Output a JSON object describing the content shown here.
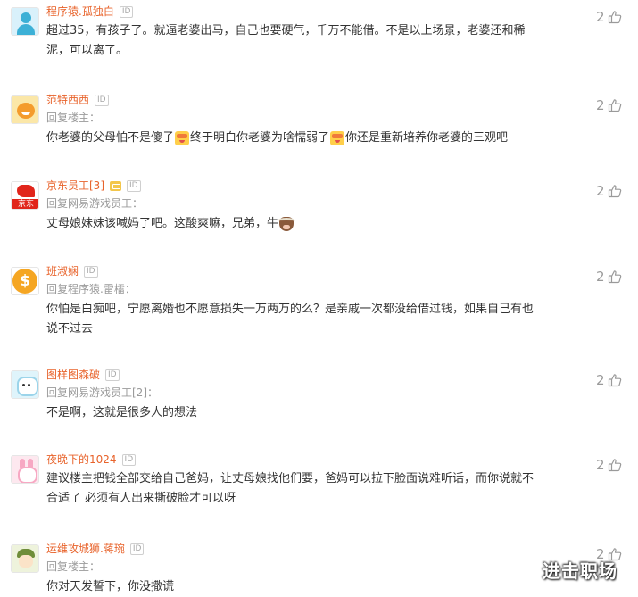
{
  "comments": [
    {
      "avatar": "person-avatar",
      "username": "程序猿.孤独白",
      "id_badge": "ID",
      "reply": "",
      "lines": [
        [
          {
            "text": "超过35，有孩子了。就逼老婆出马，自己也要硬气，千万不能借。不是以上场景，老婆还和稀"
          }
        ],
        [
          {
            "text": "泥，可以离了。"
          }
        ]
      ],
      "likes": "2"
    },
    {
      "avatar": "smile-face-avatar",
      "username": "范特西西",
      "id_badge": "ID",
      "reply": "回复楼主：",
      "lines": [
        [
          {
            "text": "你老婆的父母怕不是傻子"
          },
          {
            "emoji": "facepalm-emoji"
          },
          {
            "text": "终于明白你老婆为啥懦弱了"
          },
          {
            "emoji": "facepalm-emoji"
          },
          {
            "text": "你还是重新培养你老婆的三观吧"
          }
        ]
      ],
      "likes": "2"
    },
    {
      "avatar": "jd-logo-avatar",
      "avatar_text": "京东",
      "username": "京东员工[3]",
      "level_badge": true,
      "id_badge": "ID",
      "reply": "回复网易游戏员工：",
      "lines": [
        [
          {
            "text": "丈母娘妹妹该喊妈了吧。这酸爽嘛，兄弟，牛"
          },
          {
            "emoji": "cow-emoji"
          }
        ]
      ],
      "likes": "2"
    },
    {
      "avatar": "coin-avatar",
      "avatar_text": "$",
      "username": "班淑娴",
      "id_badge": "ID",
      "reply": "回复程序猿.雷檑：",
      "lines": [
        [
          {
            "text": "你怕是白痴吧，宁愿离婚也不愿意损失一万两万的么？是亲戚一次都没给借过钱，如果自己有也"
          }
        ],
        [
          {
            "text": "说不过去"
          }
        ]
      ],
      "likes": "2"
    },
    {
      "avatar": "cartoon-avatar",
      "username": "图样图森破",
      "id_badge": "ID",
      "reply": "回复网易游戏员工[2]：",
      "lines": [
        [
          {
            "text": "不是啊，这就是很多人的想法"
          }
        ]
      ],
      "likes": "2"
    },
    {
      "avatar": "bunny-avatar",
      "username": "夜晚下的1024",
      "id_badge": "ID",
      "reply": "",
      "lines": [
        [
          {
            "text": "建议楼主把钱全部交给自己爸妈，让丈母娘找他们要，爸妈可以拉下脸面说难听话，而你说就不"
          }
        ],
        [
          {
            "text": "合适了 必须有人出来撕破脸才可以呀"
          }
        ]
      ],
      "likes": "2"
    },
    {
      "avatar": "character-avatar",
      "username": "运维攻城狮.蒋琬",
      "id_badge": "ID",
      "reply": "回复楼主：",
      "lines": [
        [
          {
            "text": "你对天发誓下，你没撒谎"
          }
        ]
      ],
      "likes": "2"
    }
  ],
  "watermark": "进击职场",
  "colors": {
    "username": "#e8632b",
    "content": "#333333",
    "meta": "#9a9a9a"
  }
}
